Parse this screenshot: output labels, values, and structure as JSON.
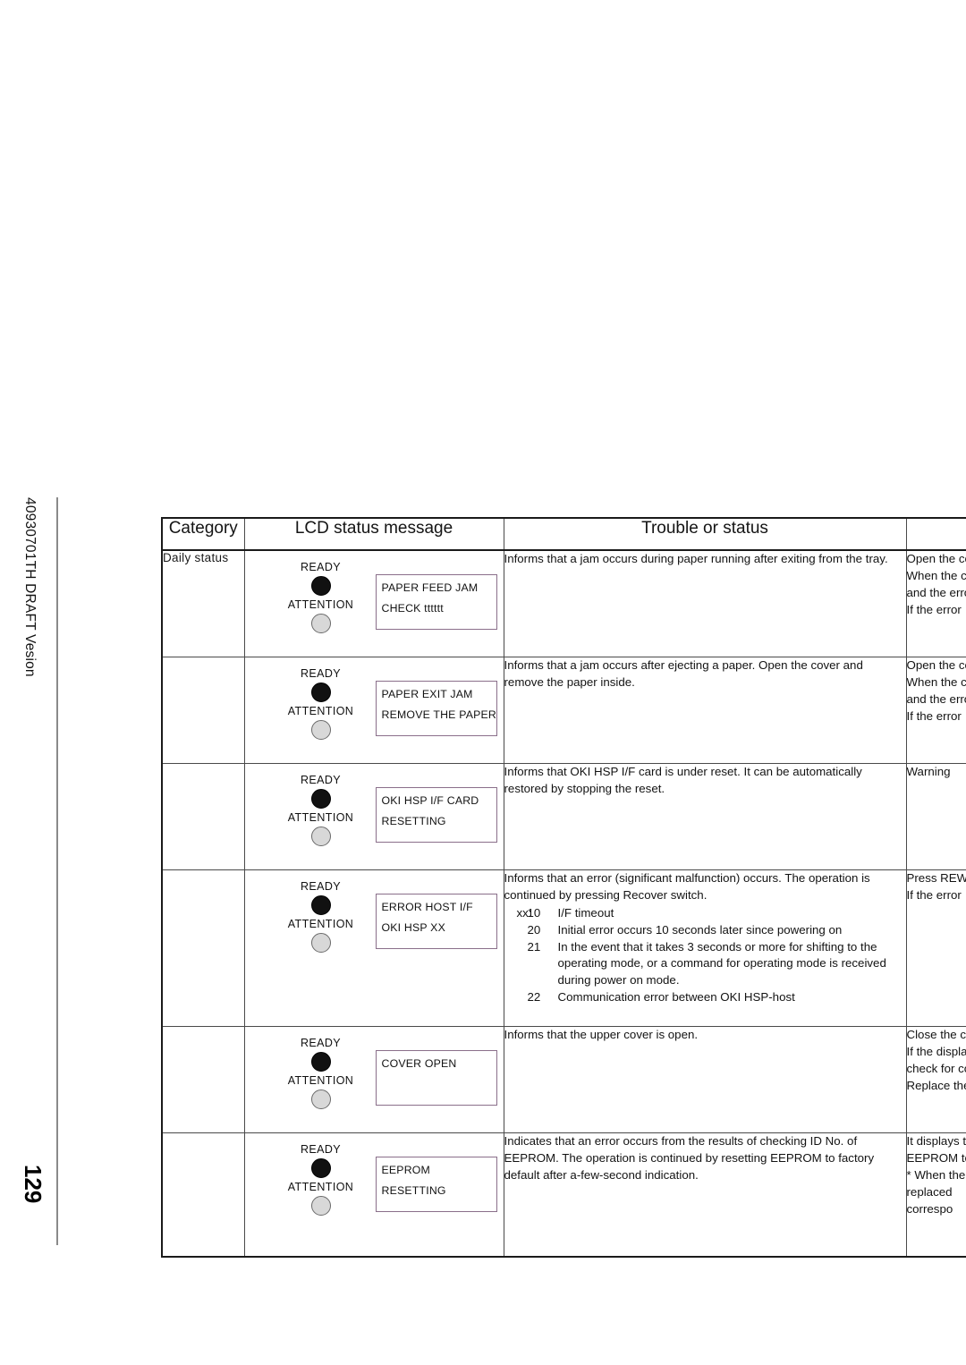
{
  "margin": {
    "draft_note": "40930701TH DRAFT Vesion",
    "page_number": "129"
  },
  "table": {
    "headers": {
      "category": "Category",
      "lcd": "LCD status message",
      "trouble": "Trouble or status",
      "remedy": ""
    },
    "rows": [
      {
        "category": "Daily  status",
        "lamps": {
          "ready_label": "READY",
          "ready_state": "on",
          "attention_label": "ATTENTION",
          "attention_state": "off"
        },
        "lcd_lines": [
          "PAPER FEED JAM",
          "CHECK tttttt"
        ],
        "trouble": "Informs that a jam occurs during paper running after exiting from the tray.",
        "trouble_sublist": [],
        "remedy_lines": [
          "Open the co",
          "When the c",
          "and the erro",
          "If the error "
        ]
      },
      {
        "category": "",
        "lamps": {
          "ready_label": "READY",
          "ready_state": "on",
          "attention_label": "ATTENTION",
          "attention_state": "off"
        },
        "lcd_lines": [
          "PAPER EXIT JAM",
          "REMOVE THE PAPER"
        ],
        "trouble": "Informs that a jam occurs after ejecting a paper. Open the cover and remove the paper inside.",
        "trouble_sublist": [],
        "remedy_lines": [
          "Open the co",
          "When the c",
          "and the erro",
          "If the error "
        ]
      },
      {
        "category": "",
        "lamps": {
          "ready_label": "READY",
          "ready_state": "on",
          "attention_label": "ATTENTION",
          "attention_state": "off"
        },
        "lcd_lines": [
          "OKI HSP I/F CARD",
          "RESETTING"
        ],
        "trouble": "Informs that OKI HSP I/F card is under reset. It can be automatically restored by stopping the reset.",
        "trouble_sublist": [],
        "remedy_lines": [
          "Warning"
        ]
      },
      {
        "category": "",
        "lamps": {
          "ready_label": "READY",
          "ready_state": "on",
          "attention_label": "ATTENTION",
          "attention_state": "off"
        },
        "lcd_lines": [
          "ERROR HOST I/F",
          "OKI HSP XX"
        ],
        "trouble": "Informs that an error (significant malfunction) occurs. The operation is continued by pressing Recover switch.",
        "trouble_sublist": [
          {
            "lead": "xx:",
            "code": "10",
            "text": "I/F timeout"
          },
          {
            "lead": "",
            "code": "20",
            "text": "Initial error occurs 10 seconds later since powering on"
          },
          {
            "lead": "",
            "code": "21",
            "text": "In the event that it takes 3 seconds or more for shifting to the operating mode, or a command for operating mode is received during power on mode."
          },
          {
            "lead": "",
            "code": "22",
            "text": "Communication error between OKI HSP-host"
          }
        ],
        "remedy_lines": [
          "Press REW",
          "If the error "
        ]
      },
      {
        "category": "",
        "lamps": {
          "ready_label": "READY",
          "ready_state": "on",
          "attention_label": "ATTENTION",
          "attention_state": "off"
        },
        "lcd_lines": [
          "COVER OPEN"
        ],
        "trouble": "Informs that the upper cover is open.",
        "trouble_sublist": [],
        "remedy_lines": [
          "Close the co",
          "If the displa",
          "check for co",
          "Replace the"
        ]
      },
      {
        "category": "",
        "lamps": {
          "ready_label": "READY",
          "ready_state": "on",
          "attention_label": "ATTENTION",
          "attention_state": "off"
        },
        "lcd_lines": [
          "EEPROM",
          "RESETTING"
        ],
        "trouble": "Indicates that an error occurs from the results of checking ID No. of EEPROM. The operation is continued by resetting EEPROM to factory default after a-few-second indication.",
        "trouble_sublist": [],
        "remedy_lines": [
          "It displays t",
          "EEPROM to",
          "*    When the",
          "     replaced",
          "     correspo"
        ]
      }
    ]
  }
}
